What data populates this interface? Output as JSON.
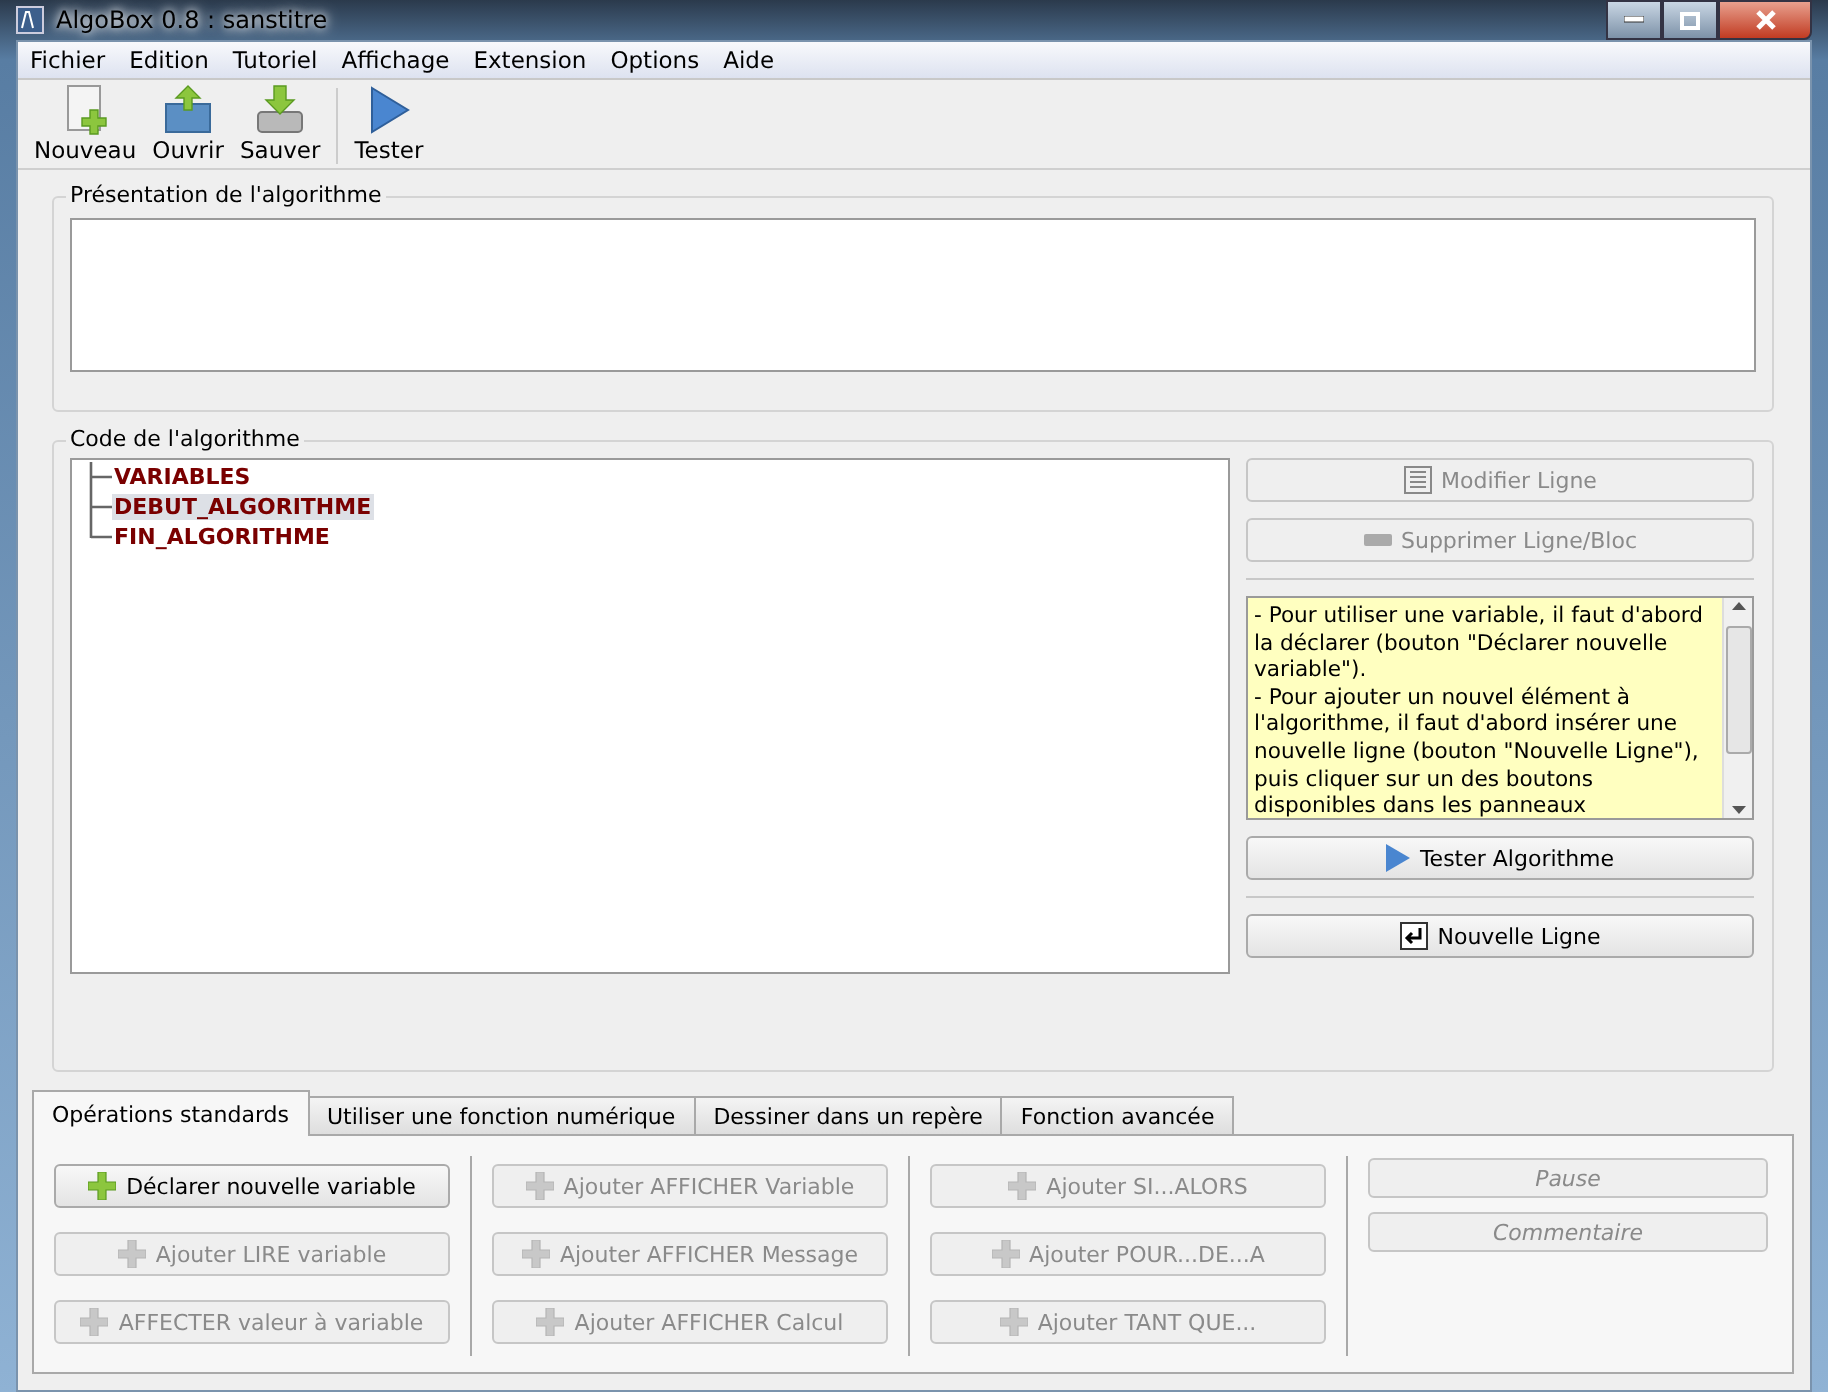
{
  "window": {
    "title": "AlgoBox 0.8 : sanstitre"
  },
  "menu": [
    "Fichier",
    "Edition",
    "Tutoriel",
    "Affichage",
    "Extension",
    "Options",
    "Aide"
  ],
  "toolbar": [
    {
      "label": "Nouveau",
      "kind": "new"
    },
    {
      "label": "Ouvrir",
      "kind": "open"
    },
    {
      "label": "Sauver",
      "kind": "save"
    },
    {
      "label": "Tester",
      "kind": "run"
    }
  ],
  "presentation": {
    "title": "Présentation de l'algorithme"
  },
  "code": {
    "title": "Code de l'algorithme",
    "tree": [
      {
        "label": "VARIABLES",
        "selected": false
      },
      {
        "label": "DEBUT_ALGORITHME",
        "selected": true
      },
      {
        "label": "FIN_ALGORITHME",
        "selected": false
      }
    ],
    "buttons": [
      {
        "label": "Modifier Ligne",
        "kind": "edit",
        "disabled": true
      },
      {
        "label": "Supprimer Ligne/Bloc",
        "kind": "delete",
        "disabled": true
      }
    ],
    "help": [
      "- Pour utiliser une variable, il faut d'abord la déclarer (bouton \"Déclarer nouvelle variable\").",
      "- Pour ajouter un nouvel élément à l'algorithme, il faut d'abord insérer une nouvelle ligne (bouton \"Nouvelle Ligne\"), puis cliquer sur un des boutons disponibles dans les panneaux"
    ],
    "run_button": {
      "label": "Tester Algorithme"
    },
    "new_line_button": {
      "label": "Nouvelle Ligne"
    }
  },
  "tabs": [
    {
      "label": "Opérations standards",
      "selected": true
    },
    {
      "label": "Utiliser une fonction numérique",
      "selected": false
    },
    {
      "label": "Dessiner dans un repère",
      "selected": false
    },
    {
      "label": "Fonction avancée",
      "selected": false
    }
  ],
  "operations": [
    [
      {
        "label": "Déclarer nouvelle variable",
        "disabled": false
      },
      {
        "label": "Ajouter LIRE variable",
        "disabled": true
      },
      {
        "label": "AFFECTER valeur à variable",
        "disabled": true
      }
    ],
    [
      {
        "label": "Ajouter AFFICHER Variable",
        "disabled": true
      },
      {
        "label": "Ajouter AFFICHER Message",
        "disabled": true
      },
      {
        "label": "Ajouter AFFICHER Calcul",
        "disabled": true
      }
    ],
    [
      {
        "label": "Ajouter SI...ALORS",
        "disabled": true
      },
      {
        "label": "Ajouter POUR...DE...A",
        "disabled": true
      },
      {
        "label": "Ajouter TANT QUE...",
        "disabled": true
      }
    ]
  ],
  "extra_buttons": [
    {
      "label": "Pause",
      "disabled": true
    },
    {
      "label": "Commentaire",
      "disabled": true
    }
  ]
}
